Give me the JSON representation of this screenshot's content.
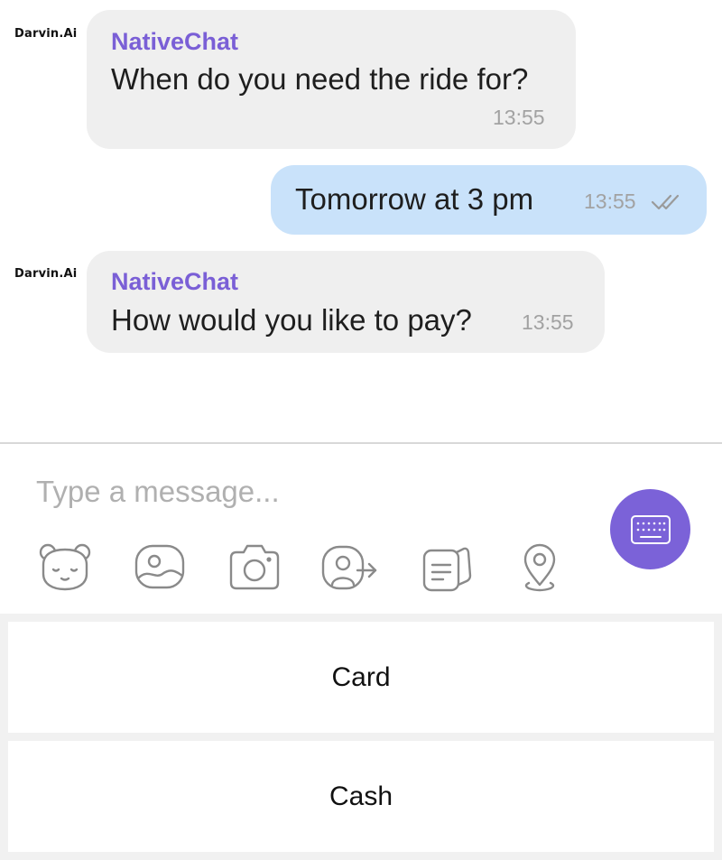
{
  "brand": {
    "avatar_label": "Darvin.Ai"
  },
  "messages": [
    {
      "direction": "incoming",
      "sender": "NativeChat",
      "text": "When do you need the ride for?",
      "time": "13:55"
    },
    {
      "direction": "outgoing",
      "text": "Tomorrow at 3 pm",
      "time": "13:55",
      "status_icon": "double-check-icon"
    },
    {
      "direction": "incoming",
      "sender": "NativeChat",
      "text": "How would you like to pay?",
      "time": "13:55"
    }
  ],
  "composer": {
    "placeholder": "Type a message...",
    "tools": [
      "sticker-icon",
      "gallery-icon",
      "camera-icon",
      "share-contact-icon",
      "documents-icon",
      "location-icon"
    ],
    "keyboard_button_icon": "keyboard-icon"
  },
  "quick_replies": [
    {
      "label": "Card"
    },
    {
      "label": "Cash"
    }
  ],
  "colors": {
    "accent": "#7b62d8",
    "sender_name": "#7a5fd6",
    "incoming_bubble": "#efefef",
    "outgoing_bubble": "#c9e2fa",
    "timestamp": "#a2a2a2"
  }
}
